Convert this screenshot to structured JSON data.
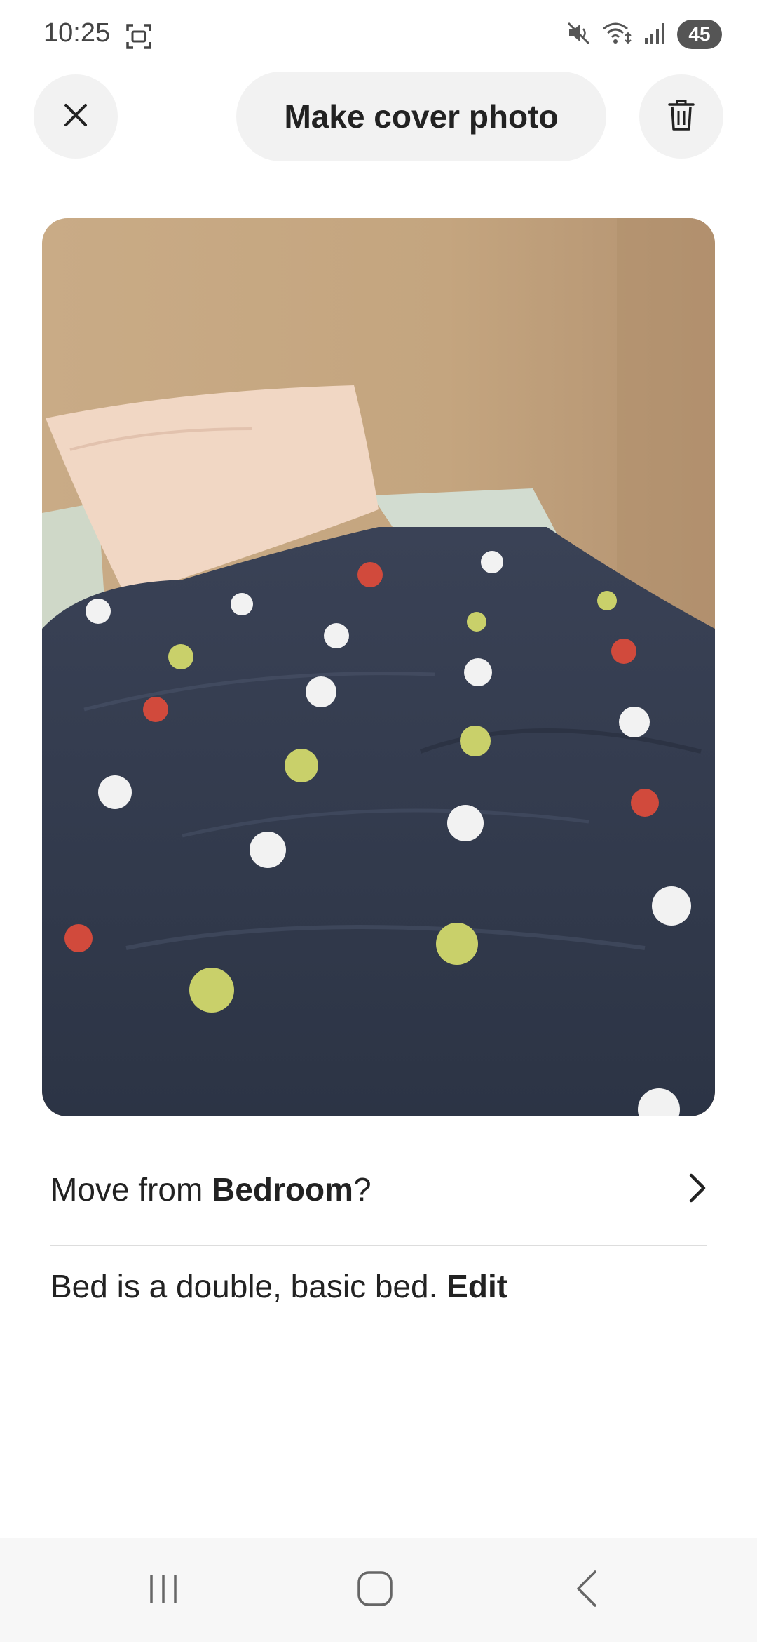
{
  "status_bar": {
    "time": "10:25",
    "battery": "45",
    "icons": [
      "screenshot-icon",
      "mute-icon",
      "wifi-icon",
      "signal-icon"
    ]
  },
  "header": {
    "close_icon": "close-icon",
    "cover_button": "Make cover photo",
    "delete_icon": "trash-icon"
  },
  "photo": {
    "subject": "bed with pillow and navy flower-embroidered duvet"
  },
  "move_row": {
    "prefix": "Move from ",
    "room": "Bedroom",
    "suffix": "?",
    "chevron_icon": "chevron-right-icon"
  },
  "bed_row": {
    "text": "Bed is a double, basic bed. ",
    "edit_label": "Edit"
  },
  "nav_bar": {
    "icons": [
      "recents-icon",
      "home-icon",
      "back-icon"
    ]
  },
  "colors": {
    "button_bg": "#f2f2f2",
    "text": "#222222",
    "divider": "#dddddd"
  }
}
